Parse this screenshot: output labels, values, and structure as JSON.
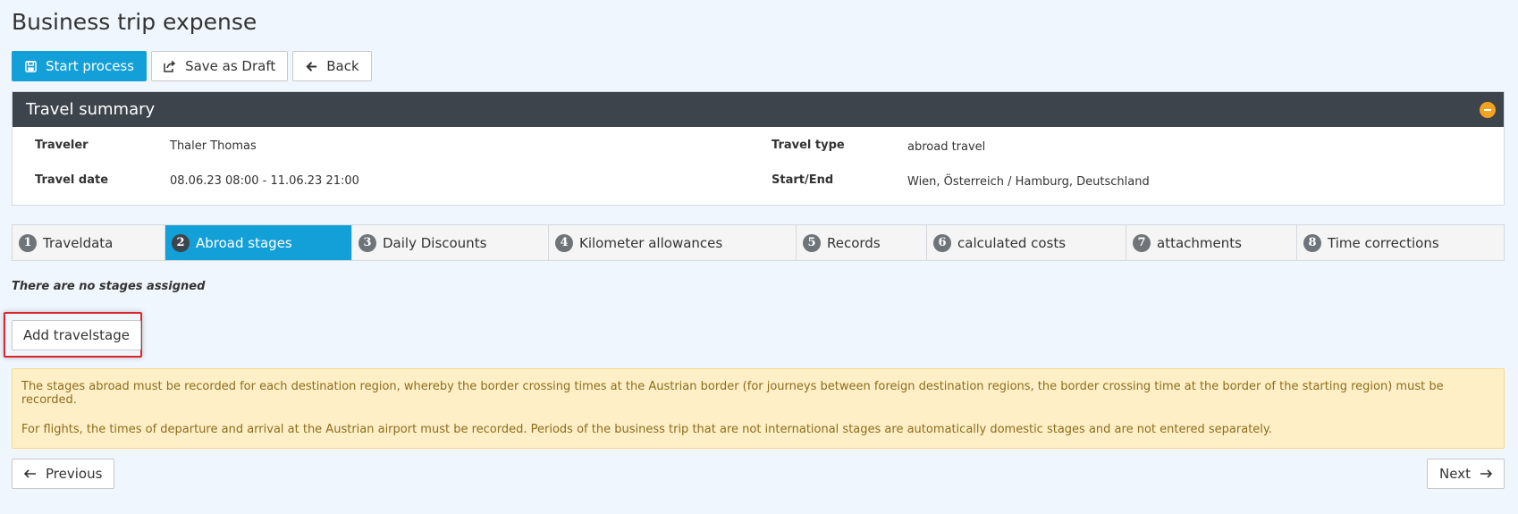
{
  "page": {
    "title": "Business trip expense"
  },
  "toolbar": {
    "start_label": "Start process",
    "draft_label": "Save as Draft",
    "back_label": "Back"
  },
  "summary": {
    "title": "Travel summary",
    "traveler_label": "Traveler",
    "traveler_value": "Thaler Thomas",
    "date_label": "Travel date",
    "date_value": "08.06.23 08:00 - 11.06.23 21:00",
    "type_label": "Travel type",
    "type_value": "abroad travel",
    "startend_label": "Start/End",
    "startend_value": "Wien, Österreich / Hamburg, Deutschland"
  },
  "tabs": [
    {
      "num": "1",
      "label": "Traveldata"
    },
    {
      "num": "2",
      "label": "Abroad stages"
    },
    {
      "num": "3",
      "label": "Daily Discounts"
    },
    {
      "num": "4",
      "label": "Kilometer allowances"
    },
    {
      "num": "5",
      "label": "Records"
    },
    {
      "num": "6",
      "label": "calculated costs"
    },
    {
      "num": "7",
      "label": "attachments"
    },
    {
      "num": "8",
      "label": "Time corrections"
    }
  ],
  "content": {
    "empty_text": "There are no stages assigned",
    "add_label": "Add travelstage",
    "info_1": "The stages abroad must be recorded for each destination region, whereby the border crossing times at the Austrian border (for journeys between foreign destination regions, the border crossing time at the border of the starting region) must be recorded.",
    "info_2": "For flights, the times of departure and arrival at the Austrian airport must be recorded. Periods of the business trip that are not international stages are automatically domestic stages and are not entered separately."
  },
  "nav": {
    "prev_label": "Previous",
    "next_label": "Next"
  },
  "colors": {
    "primary": "#139fd7",
    "header": "#3e444b",
    "collapse": "#f3a31f",
    "alert_bg": "#feefc6",
    "highlight": "#d9262b"
  }
}
